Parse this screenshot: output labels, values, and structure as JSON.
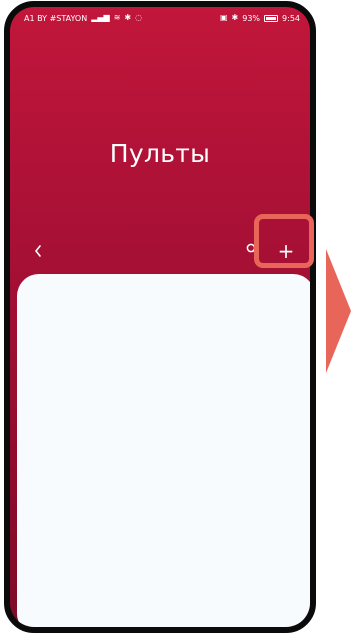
{
  "status_bar": {
    "carrier": "A1 BY #STAYON",
    "battery": "93%",
    "time": "9:54"
  },
  "header": {
    "title": "Пульты",
    "back_icon": "chevron-left-icon",
    "search_icon": "search-icon",
    "add_label": "+"
  },
  "colors": {
    "header_top": "#c2163b",
    "header_bottom": "#7d0b27",
    "highlight": "#e8655a",
    "card": "#f7fbfd"
  }
}
